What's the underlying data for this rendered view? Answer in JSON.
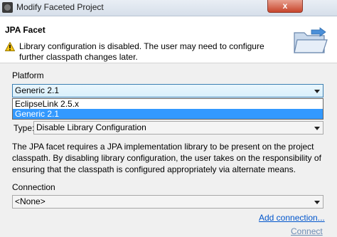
{
  "window": {
    "title": "Modify Faceted Project",
    "close_label": "x"
  },
  "header": {
    "title": "JPA Facet",
    "message": "Library configuration is disabled. The user may need to configure further classpath changes later.",
    "message_icon": "warning-icon",
    "banner_icon": "folder-icon"
  },
  "platform": {
    "label": "Platform",
    "selected": "Generic 2.1",
    "options": [
      "EclipseLink 2.5.x",
      "Generic 2.1"
    ],
    "highlighted_option": "Generic 2.1"
  },
  "library": {
    "type_label": "Type:",
    "type_value": "Disable Library Configuration",
    "description": "The JPA facet requires a JPA implementation library to be present on the project classpath. By disabling library configuration, the user takes on the responsibility of ensuring that the classpath is configured appropriately via alternate means."
  },
  "connection": {
    "label": "Connection",
    "selected": "<None>",
    "add_link": "Add connection...",
    "connect_link": "Connect"
  },
  "colors": {
    "selection": "#3399ff",
    "link": "#0055cc",
    "close_button": "#c7452c"
  }
}
